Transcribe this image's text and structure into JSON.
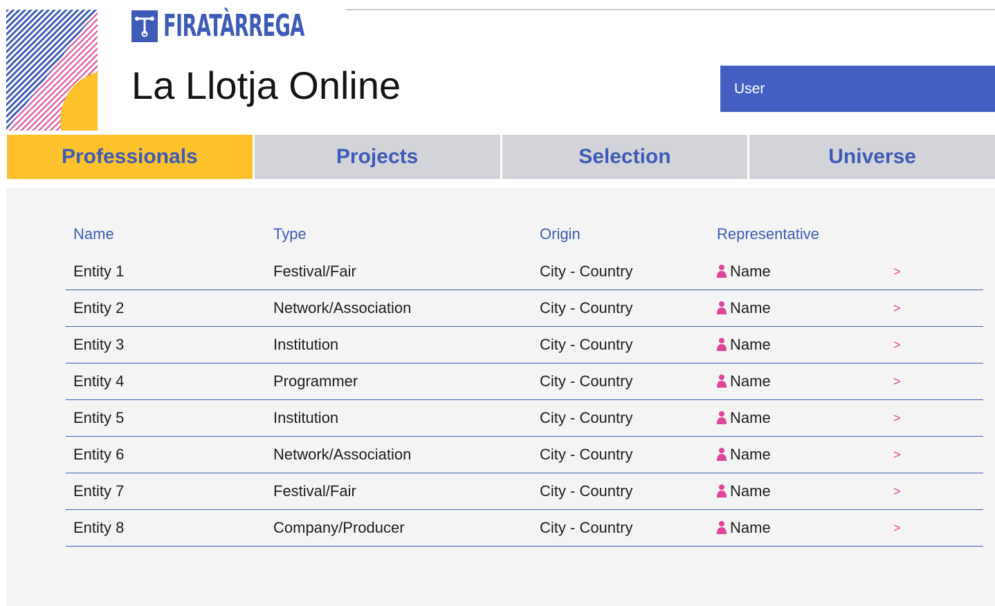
{
  "header": {
    "brand_logo_text": "FIRATÀRREGA",
    "app_title": "La Llotja Online",
    "user_label": "User"
  },
  "tabs": [
    {
      "label": "Professionals",
      "active": true
    },
    {
      "label": "Projects",
      "active": false
    },
    {
      "label": "Selection",
      "active": false
    },
    {
      "label": "Universe",
      "active": false
    }
  ],
  "table": {
    "columns": [
      "Name",
      "Type",
      "Origin",
      "Representative"
    ],
    "rows": [
      {
        "name": "Entity 1",
        "type": "Festival/Fair",
        "origin": "City - Country",
        "representative": "Name",
        "action": ">"
      },
      {
        "name": "Entity 2",
        "type": "Network/Association",
        "origin": "City - Country",
        "representative": "Name",
        "action": ">"
      },
      {
        "name": "Entity 3",
        "type": "Institution",
        "origin": "City - Country",
        "representative": "Name",
        "action": ">"
      },
      {
        "name": "Entity 4",
        "type": "Programmer",
        "origin": "City - Country",
        "representative": "Name",
        "action": ">"
      },
      {
        "name": "Entity 5",
        "type": "Institution",
        "origin": "City - Country",
        "representative": "Name",
        "action": ">"
      },
      {
        "name": "Entity 6",
        "type": "Network/Association",
        "origin": "City - Country",
        "representative": "Name",
        "action": ">"
      },
      {
        "name": "Entity 7",
        "type": "Festival/Fair",
        "origin": "City - Country",
        "representative": "Name",
        "action": ">"
      },
      {
        "name": "Entity 8",
        "type": "Company/Producer",
        "origin": "City - Country",
        "representative": "Name",
        "action": ">"
      }
    ]
  },
  "icons": {
    "representative": "person-icon",
    "row_action": "chevron-right-icon"
  },
  "colors": {
    "brand_blue": "#3f5bb8",
    "user_button": "#435fc2",
    "active_tab": "#fcc12b",
    "inactive_tab": "#d2d4d9",
    "accent_pink": "#e0459a",
    "panel_bg": "#f4f4f4"
  }
}
